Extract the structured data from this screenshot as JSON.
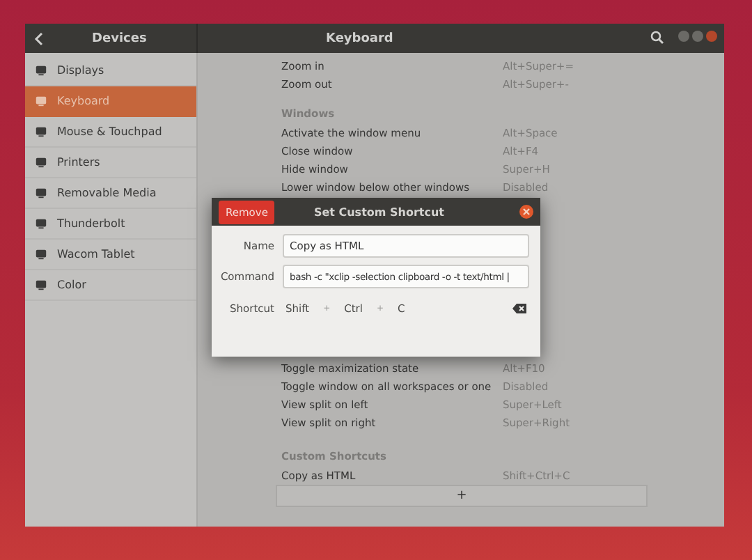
{
  "window": {
    "sidebar_title": "Devices",
    "title": "Keyboard"
  },
  "sidebar": {
    "items": [
      {
        "label": "Displays",
        "selected": false
      },
      {
        "label": "Keyboard",
        "selected": true
      },
      {
        "label": "Mouse & Touchpad",
        "selected": false
      },
      {
        "label": "Printers",
        "selected": false
      },
      {
        "label": "Removable Media",
        "selected": false
      },
      {
        "label": "Thunderbolt",
        "selected": false
      },
      {
        "label": "Wacom Tablet",
        "selected": false
      },
      {
        "label": "Color",
        "selected": false
      }
    ]
  },
  "shortcuts": [
    {
      "kind": "row",
      "name": "Zoom in",
      "shortcut": "Alt+Super+="
    },
    {
      "kind": "row",
      "name": "Zoom out",
      "shortcut": "Alt+Super+-"
    },
    {
      "kind": "section",
      "name": "Windows"
    },
    {
      "kind": "row",
      "name": "Activate the window menu",
      "shortcut": "Alt+Space"
    },
    {
      "kind": "row",
      "name": "Close window",
      "shortcut": "Alt+F4"
    },
    {
      "kind": "row",
      "name": "Hide window",
      "shortcut": "Super+H"
    },
    {
      "kind": "row",
      "name": "Lower window below other windows",
      "shortcut": "Disabled"
    },
    {
      "kind": "row"
    },
    {
      "kind": "row"
    },
    {
      "kind": "row"
    },
    {
      "kind": "row"
    },
    {
      "kind": "row"
    },
    {
      "kind": "row"
    },
    {
      "kind": "row"
    },
    {
      "kind": "row"
    },
    {
      "kind": "row"
    },
    {
      "kind": "row",
      "name": "Toggle maximization state",
      "shortcut": "Alt+F10"
    },
    {
      "kind": "row",
      "name": "Toggle window on all workspaces or one",
      "shortcut": "Disabled"
    },
    {
      "kind": "row",
      "name": "View split on left",
      "shortcut": "Super+Left"
    },
    {
      "kind": "row",
      "name": "View split on right",
      "shortcut": "Super+Right"
    },
    {
      "kind": "section",
      "name": "Custom Shortcuts"
    },
    {
      "kind": "row",
      "name": "Copy as HTML",
      "shortcut": "Shift+Ctrl+C"
    },
    {
      "kind": "add",
      "name": "+"
    }
  ],
  "dialog": {
    "remove_button": "Remove",
    "title": "Set Custom Shortcut",
    "name_label": "Name",
    "name_value": "Copy as HTML",
    "command_label": "Command",
    "command_value": "bash -c \"xclip -selection clipboard -o -t text/html |",
    "shortcut_label": "Shortcut",
    "keys": [
      "Shift",
      "+",
      "Ctrl",
      "+",
      "C"
    ]
  }
}
